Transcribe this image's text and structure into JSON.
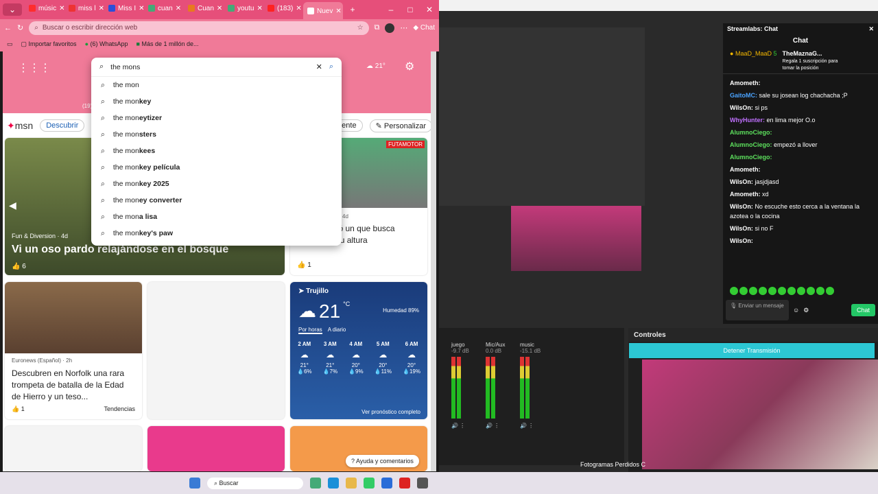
{
  "browser": {
    "tabs": [
      {
        "label": "músic",
        "color": "#ff2d2d"
      },
      {
        "label": "miss l",
        "color": "#e33"
      },
      {
        "label": "Miss I",
        "color": "#2b4fd8"
      },
      {
        "label": "cuan",
        "color": "#4a7"
      },
      {
        "label": "Cuan",
        "color": "#e87a1e"
      },
      {
        "label": "youtu",
        "color": "#4a7"
      },
      {
        "label": "(183)",
        "color": "#f22"
      },
      {
        "label": "Nuev",
        "color": "#fff"
      }
    ],
    "address_placeholder": "Buscar o escribir dirección web",
    "copilot_label": "Chat",
    "favorites": [
      {
        "label": "Importar favoritos"
      },
      {
        "label": "(6) WhatsApp"
      },
      {
        "label": "Más de 1 millón de..."
      }
    ],
    "weather_temp": "21°",
    "hero_small": "(19)"
  },
  "search": {
    "query": "the mons",
    "suggestions": [
      {
        "prefix": "the mon",
        "bold": ""
      },
      {
        "prefix": "the mon",
        "bold": "key"
      },
      {
        "prefix": "the mon",
        "bold": "eytizer"
      },
      {
        "prefix": "the mon",
        "bold": "sters"
      },
      {
        "prefix": "the mon",
        "bold": "kees"
      },
      {
        "prefix": "the mon",
        "bold": "key película"
      },
      {
        "prefix": "the mon",
        "bold": "key 2025"
      },
      {
        "prefix": "the mon",
        "bold": "ey converter"
      },
      {
        "prefix": "the mon",
        "bold": "a lisa"
      },
      {
        "prefix": "the mon",
        "bold": "key's paw"
      }
    ]
  },
  "msn": {
    "logo": "msn",
    "discover": "Descubrir",
    "source": "fuente",
    "personalize": "Personalizar",
    "hero": {
      "source": "Fun & Diversion · 4d",
      "title": "Vi un oso pardo relajándose en el bosque",
      "likes": "6"
    },
    "side": {
      "badge": "FUTAMOTOR",
      "age": "4d",
      "title": "al T2 le salió un que busca ponerse a su altura",
      "likes": "1"
    },
    "news": {
      "source": "Euronews (Español) · 2h",
      "title": "Descubren en Norfolk una rara trompeta de batalla de la Edad de Hierro y un teso...",
      "likes": "1",
      "tag": "Tendencias"
    },
    "weather": {
      "city": "Trujillo",
      "temp": "21",
      "unit": "°C",
      "humidity": "Humedad 89%",
      "tab1": "Por horas",
      "tab2": "A diario",
      "hours": [
        {
          "h": "2 AM",
          "t": "21°",
          "p": "6%"
        },
        {
          "h": "3 AM",
          "t": "21°",
          "p": "7%"
        },
        {
          "h": "4 AM",
          "t": "20°",
          "p": "9%"
        },
        {
          "h": "5 AM",
          "t": "20°",
          "p": "11%"
        },
        {
          "h": "6 AM",
          "t": "20°",
          "p": "19%"
        }
      ],
      "link": "Ver pronóstico completo"
    },
    "feedback": "Ayuda y comentarios"
  },
  "taskbar": {
    "search": "Buscar"
  },
  "chat": {
    "title": "Streamlabs: Chat",
    "header": "Chat",
    "top_user": "MaaD_MaaD",
    "top_count": "5",
    "sub_user": "TheMaznaG...",
    "sub_text": "Regala 1 suscripción para tomar la posición",
    "messages": [
      {
        "user": "Amometh:",
        "text": "",
        "color": "#fff"
      },
      {
        "user": "GaitoMC:",
        "text": "sale su josean log chachacha ;P",
        "color": "#4aa3ff"
      },
      {
        "user": "WilsOn:",
        "text": "si ps",
        "color": "#fff"
      },
      {
        "user": "WhyHunter:",
        "text": "en lima mejor O.o",
        "color": "#c070ff"
      },
      {
        "user": "AlumnoCiego:",
        "text": "",
        "color": "#5de05d"
      },
      {
        "user": "AlumnoCiego:",
        "text": "empezó a llover",
        "color": "#5de05d"
      },
      {
        "user": "AlumnoCiego:",
        "text": "",
        "color": "#5de05d"
      },
      {
        "user": "Amometh:",
        "text": "",
        "color": "#fff"
      },
      {
        "user": "WilsOn:",
        "text": "jasjdjasd",
        "color": "#fff"
      },
      {
        "user": "Amometh:",
        "text": "xd",
        "color": "#fff"
      },
      {
        "user": "WilsOn:",
        "text": "No escuche esto cerca a la ventana la azotea o la cocina",
        "color": "#fff"
      },
      {
        "user": "WilsOn:",
        "text": "si no F",
        "color": "#fff"
      },
      {
        "user": "WilsOn:",
        "text": "",
        "color": "#fff"
      }
    ],
    "send_placeholder": "Enviar un mensaje",
    "chat_btn": "Chat"
  },
  "mixer": {
    "channels": [
      {
        "name": "juego",
        "db": "-9.7 dB"
      },
      {
        "name": "Mic/Aux",
        "db": "0.0 dB"
      },
      {
        "name": "music",
        "db": "-15.1 dB"
      }
    ]
  },
  "controls": {
    "title": "Controles",
    "stop": "Detener Transmisión",
    "frames": "Fotogramas Perdidos C"
  }
}
